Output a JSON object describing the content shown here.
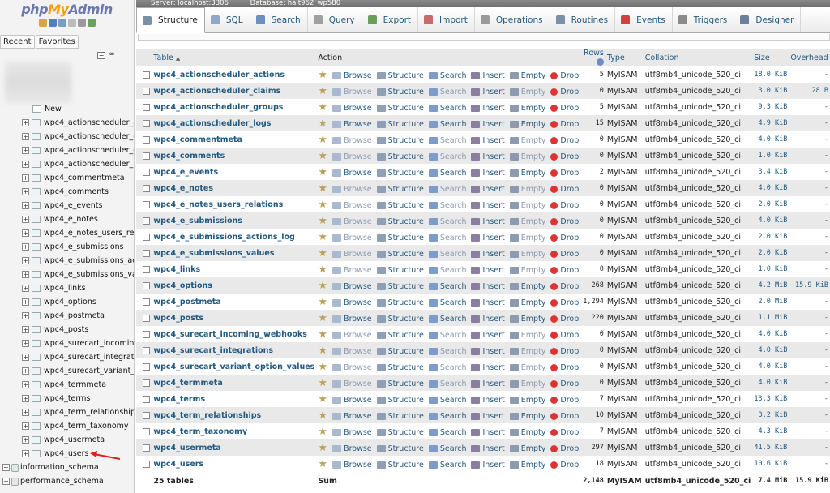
{
  "nav": {
    "logo_php": "php",
    "logo_my": "My",
    "logo_admin": "Admin",
    "tabs": [
      "Recent",
      "Favorites"
    ],
    "new_label": "New",
    "tables": [
      "wpc4_actionscheduler_ac",
      "wpc4_actionscheduler_cla",
      "wpc4_actionscheduler_gro",
      "wpc4_actionscheduler_log",
      "wpc4_commentmeta",
      "wpc4_comments",
      "wpc4_e_events",
      "wpc4_e_notes",
      "wpc4_e_notes_users_rela",
      "wpc4_e_submissions",
      "wpc4_e_submissions_acti",
      "wpc4_e_submissions_valu",
      "wpc4_links",
      "wpc4_options",
      "wpc4_postmeta",
      "wpc4_posts",
      "wpc4_surecart_incoming_",
      "wpc4_surecart_integration",
      "wpc4_surecart_variant_op",
      "wpc4_termmeta",
      "wpc4_terms",
      "wpc4_term_relationships",
      "wpc4_term_taxonomy",
      "wpc4_usermeta",
      "wpc4_users"
    ],
    "databases": [
      "information_schema",
      "performance_schema"
    ]
  },
  "topbar": {
    "server": "Server: localhost:3306",
    "database": "Database: hait962_wp580"
  },
  "tabs": [
    {
      "label": "Structure",
      "icon": "structure-icon",
      "color": "#7a8fa8"
    },
    {
      "label": "SQL",
      "icon": "sql-icon",
      "color": "#8fa7c9"
    },
    {
      "label": "Search",
      "icon": "search-icon",
      "color": "#6b8fc0"
    },
    {
      "label": "Query",
      "icon": "query-icon",
      "color": "#a0a0a0"
    },
    {
      "label": "Export",
      "icon": "export-icon",
      "color": "#6c9f5c"
    },
    {
      "label": "Import",
      "icon": "import-icon",
      "color": "#c76b6b"
    },
    {
      "label": "Operations",
      "icon": "wrench-icon",
      "color": "#9a9a9a"
    },
    {
      "label": "Routines",
      "icon": "routines-icon",
      "color": "#7a8fa8"
    },
    {
      "label": "Events",
      "icon": "clock-icon",
      "color": "#d34040"
    },
    {
      "label": "Triggers",
      "icon": "triggers-icon",
      "color": "#8a8a8a"
    },
    {
      "label": "Designer",
      "icon": "designer-icon",
      "color": "#6a7f9a"
    }
  ],
  "table": {
    "headers": {
      "table": "Table",
      "action": "Action",
      "rows": "Rows",
      "type": "Type",
      "collation": "Collation",
      "size": "Size",
      "overhead": "Overhead"
    },
    "actions": [
      "Browse",
      "Structure",
      "Search",
      "Insert",
      "Empty",
      "Drop"
    ],
    "rows": [
      {
        "name": "wpc4_actionscheduler_actions",
        "rows": "5",
        "type": "MyISAM",
        "collation": "utf8mb4_unicode_520_ci",
        "size": "18.0 KiB",
        "overhead": "-"
      },
      {
        "name": "wpc4_actionscheduler_claims",
        "rows": "0",
        "type": "MyISAM",
        "collation": "utf8mb4_unicode_520_ci",
        "size": "3.0 KiB",
        "overhead": "28 B"
      },
      {
        "name": "wpc4_actionscheduler_groups",
        "rows": "5",
        "type": "MyISAM",
        "collation": "utf8mb4_unicode_520_ci",
        "size": "9.3 KiB",
        "overhead": "-"
      },
      {
        "name": "wpc4_actionscheduler_logs",
        "rows": "15",
        "type": "MyISAM",
        "collation": "utf8mb4_unicode_520_ci",
        "size": "4.9 KiB",
        "overhead": "-"
      },
      {
        "name": "wpc4_commentmeta",
        "rows": "0",
        "type": "MyISAM",
        "collation": "utf8mb4_unicode_520_ci",
        "size": "4.0 KiB",
        "overhead": "-"
      },
      {
        "name": "wpc4_comments",
        "rows": "0",
        "type": "MyISAM",
        "collation": "utf8mb4_unicode_520_ci",
        "size": "1.0 KiB",
        "overhead": "-"
      },
      {
        "name": "wpc4_e_events",
        "rows": "2",
        "type": "MyISAM",
        "collation": "utf8mb4_unicode_520_ci",
        "size": "3.4 KiB",
        "overhead": "-"
      },
      {
        "name": "wpc4_e_notes",
        "rows": "0",
        "type": "MyISAM",
        "collation": "utf8mb4_unicode_520_ci",
        "size": "4.0 KiB",
        "overhead": "-"
      },
      {
        "name": "wpc4_e_notes_users_relations",
        "rows": "0",
        "type": "MyISAM",
        "collation": "utf8mb4_unicode_520_ci",
        "size": "2.0 KiB",
        "overhead": "-"
      },
      {
        "name": "wpc4_e_submissions",
        "rows": "0",
        "type": "MyISAM",
        "collation": "utf8mb4_unicode_520_ci",
        "size": "4.0 KiB",
        "overhead": "-"
      },
      {
        "name": "wpc4_e_submissions_actions_log",
        "rows": "0",
        "type": "MyISAM",
        "collation": "utf8mb4_unicode_520_ci",
        "size": "2.0 KiB",
        "overhead": "-"
      },
      {
        "name": "wpc4_e_submissions_values",
        "rows": "0",
        "type": "MyISAM",
        "collation": "utf8mb4_unicode_520_ci",
        "size": "2.0 KiB",
        "overhead": "-"
      },
      {
        "name": "wpc4_links",
        "rows": "0",
        "type": "MyISAM",
        "collation": "utf8mb4_unicode_520_ci",
        "size": "1.0 KiB",
        "overhead": "-"
      },
      {
        "name": "wpc4_options",
        "rows": "268",
        "type": "MyISAM",
        "collation": "utf8mb4_unicode_520_ci",
        "size": "4.2 MiB",
        "overhead": "15.9 KiB"
      },
      {
        "name": "wpc4_postmeta",
        "rows": "1,294",
        "type": "MyISAM",
        "collation": "utf8mb4_unicode_520_ci",
        "size": "2.0 MiB",
        "overhead": "-"
      },
      {
        "name": "wpc4_posts",
        "rows": "220",
        "type": "MyISAM",
        "collation": "utf8mb4_unicode_520_ci",
        "size": "1.1 MiB",
        "overhead": "-"
      },
      {
        "name": "wpc4_surecart_incoming_webhooks",
        "rows": "0",
        "type": "MyISAM",
        "collation": "utf8mb4_unicode_520_ci",
        "size": "4.0 KiB",
        "overhead": "-"
      },
      {
        "name": "wpc4_surecart_integrations",
        "rows": "0",
        "type": "MyISAM",
        "collation": "utf8mb4_unicode_520_ci",
        "size": "4.0 KiB",
        "overhead": "-"
      },
      {
        "name": "wpc4_surecart_variant_option_values",
        "rows": "0",
        "type": "MyISAM",
        "collation": "utf8mb4_unicode_520_ci",
        "size": "4.0 KiB",
        "overhead": "-"
      },
      {
        "name": "wpc4_termmeta",
        "rows": "0",
        "type": "MyISAM",
        "collation": "utf8mb4_unicode_520_ci",
        "size": "4.0 KiB",
        "overhead": "-"
      },
      {
        "name": "wpc4_terms",
        "rows": "7",
        "type": "MyISAM",
        "collation": "utf8mb4_unicode_520_ci",
        "size": "13.3 KiB",
        "overhead": "-"
      },
      {
        "name": "wpc4_term_relationships",
        "rows": "10",
        "type": "MyISAM",
        "collation": "utf8mb4_unicode_520_ci",
        "size": "3.2 KiB",
        "overhead": "-"
      },
      {
        "name": "wpc4_term_taxonomy",
        "rows": "7",
        "type": "MyISAM",
        "collation": "utf8mb4_unicode_520_ci",
        "size": "4.3 KiB",
        "overhead": "-"
      },
      {
        "name": "wpc4_usermeta",
        "rows": "297",
        "type": "MyISAM",
        "collation": "utf8mb4_unicode_520_ci",
        "size": "41.5 KiB",
        "overhead": "-"
      },
      {
        "name": "wpc4_users",
        "rows": "18",
        "type": "MyISAM",
        "collation": "utf8mb4_unicode_520_ci",
        "size": "10.6 KiB",
        "overhead": "-"
      }
    ],
    "footer": {
      "count": "25 tables",
      "sum": "Sum",
      "rows": "2,148",
      "type": "MyISAM",
      "collation": "utf8mb4_unicode_520_ci",
      "size": "7.4 MiB",
      "overhead": "15.9 KiB"
    }
  },
  "colors": {
    "accent": "#235a81",
    "drop": "#d33333",
    "row_alt": "#e9e9e9"
  }
}
